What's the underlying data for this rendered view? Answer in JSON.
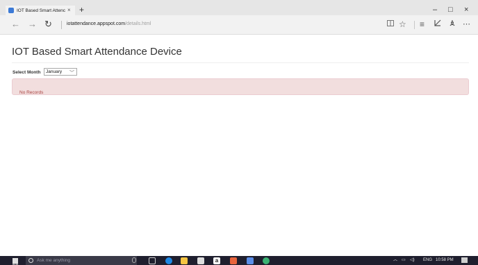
{
  "browser": {
    "tab_title": "IOT Based Smart Attenc",
    "tab_close": "×",
    "new_tab": "+",
    "window_controls": [
      "–",
      "□",
      "×"
    ],
    "nav": {
      "back": "←",
      "forward": "→",
      "refresh": "↻"
    },
    "address": {
      "domain": "iotattendance.appspot.com",
      "path": "/details.html"
    },
    "toolbar": [
      "reading-view",
      "favorite",
      "hub",
      "web-note",
      "share",
      "more"
    ]
  },
  "page": {
    "title": "IOT Based Smart Attendance Device",
    "month_label": "Select Month",
    "month_selected": "January",
    "alert": "No Records",
    "alert_color": "#a94442",
    "alert_bg": "#f2dede"
  },
  "taskbar": {
    "search_placeholder": "Ask me anything",
    "language": "ENG",
    "time": "10:58 PM"
  }
}
